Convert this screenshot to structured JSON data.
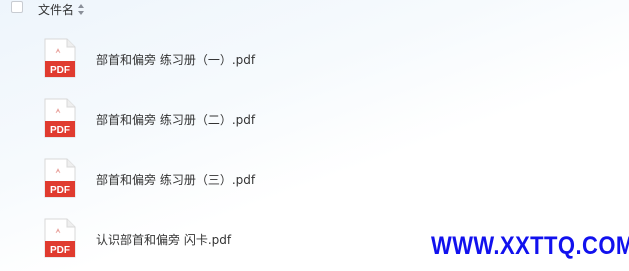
{
  "header": {
    "column_name": "文件名",
    "sort_icon": "sort-icon"
  },
  "files": [
    {
      "icon": "pdf-file-icon",
      "icon_label": "PDF",
      "name": "部首和偏旁 练习册（一）.pdf"
    },
    {
      "icon": "pdf-file-icon",
      "icon_label": "PDF",
      "name": "部首和偏旁 练习册（二）.pdf"
    },
    {
      "icon": "pdf-file-icon",
      "icon_label": "PDF",
      "name": "部首和偏旁 练习册（三）.pdf"
    },
    {
      "icon": "pdf-file-icon",
      "icon_label": "PDF",
      "name": "认识部首和偏旁 闪卡.pdf"
    }
  ],
  "watermark": "WWW.XXTTQ.COM",
  "colors": {
    "pdf_red": "#e03b2f",
    "watermark_blue": "#1111ee"
  }
}
